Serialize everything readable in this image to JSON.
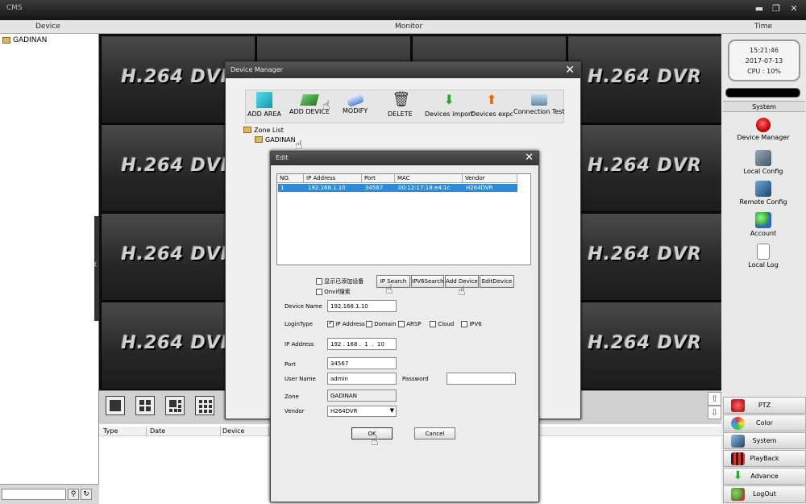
{
  "window": {
    "title": "CMS"
  },
  "header": {
    "device": "Device",
    "monitor": "Monitor",
    "time": "Time"
  },
  "device_tree": {
    "root": "GADINAN"
  },
  "video_grid": {
    "label": "H.264 DVR"
  },
  "log_table": {
    "columns": [
      "Type",
      "Date",
      "Device"
    ]
  },
  "clock": {
    "time": "15:21:46",
    "date": "2017-07-13",
    "cpu": "CPU : 10%"
  },
  "system_panel": {
    "header": "System",
    "items": [
      "Device Manager",
      "Local Config",
      "Remote Config",
      "Account",
      "Local Log"
    ]
  },
  "bottom_buttons": [
    "PTZ",
    "Color",
    "System",
    "PlayBack",
    "Advance",
    "LogOut"
  ],
  "device_manager": {
    "title": "Device Manager",
    "toolbar": [
      "ADD AREA",
      "ADD DEVICE",
      "MODIFY",
      "DELETE",
      "Devices import",
      "Devices expo",
      "Connection  Test"
    ],
    "zone_list": "Zone List",
    "zone_item": "GADINAN"
  },
  "edit_dialog": {
    "title": "Edit",
    "table": {
      "columns": [
        "NO.",
        "IP Address",
        "Port",
        "MAC",
        "Vendor"
      ],
      "rows": [
        [
          "1",
          "192.168.1.10",
          "34567",
          "00:12:17:18:e4:1c",
          "H264DVR"
        ]
      ]
    },
    "show_added": "显示已添加设备",
    "onvif": "Onvif搜索",
    "buttons": {
      "ip_search": "IP Search",
      "ipv6_search": "IPV6Search",
      "add_device": "Add Device",
      "edit_device": "EditDevice"
    },
    "labels": {
      "device_name": "Device Name",
      "login_type": "LoginType",
      "ip_address": "IP Address",
      "port": "Port",
      "user_name": "User Name",
      "password": "Password",
      "zone": "Zone",
      "vendor": "Vendor"
    },
    "login_types": [
      "IP Address",
      "Domain",
      "ARSP",
      "Cloud",
      "IPV6"
    ],
    "values": {
      "device_name": "192.168.1.10",
      "ip_address": "192 . 168 .  1  .  10",
      "port": "34567",
      "user_name": "admin",
      "password": "",
      "zone": "GADINAN",
      "vendor": "H264DVR"
    },
    "ok": "OK",
    "cancel": "Cancel"
  },
  "colors": {
    "selection": "#2f8bd8",
    "titlebar": "#333333"
  }
}
